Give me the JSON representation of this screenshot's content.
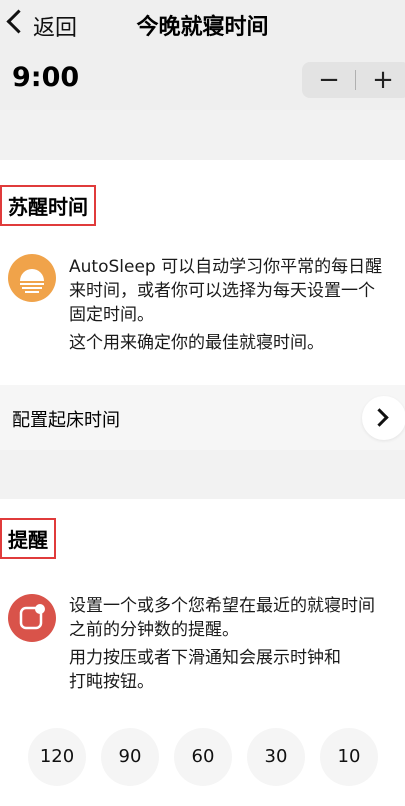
{
  "nav": {
    "back_label": "返回",
    "title": "今晚就寝时间"
  },
  "time": {
    "value": "9:00",
    "minus_label": "−",
    "plus_label": "+"
  },
  "wake_section": {
    "title": "苏醒时间",
    "desc_line1": "AutoSleep 可以自动学习你平常的每日醒",
    "desc_line2": "来时间，或者你可以选择为每天设置一个",
    "desc_line3": "固定时间。",
    "desc_line4": "这个用来确定你的最佳就寝时间。",
    "config_label": "配置起床时间"
  },
  "reminder_section": {
    "title": "提醒",
    "desc_line1": "设置一个或多个您希望在最近的就寝时间",
    "desc_line2": "之前的分钟数的提醒。",
    "desc_line3": "用力按压或者下滑通知会展示时钟和",
    "desc_line4": "打盹按钮。",
    "options": [
      "120",
      "90",
      "60",
      "30",
      "10"
    ]
  },
  "colors": {
    "sun_icon": "#f0a34a",
    "reminder_icon": "#d9534a",
    "highlight_box": "#e03b3b"
  }
}
